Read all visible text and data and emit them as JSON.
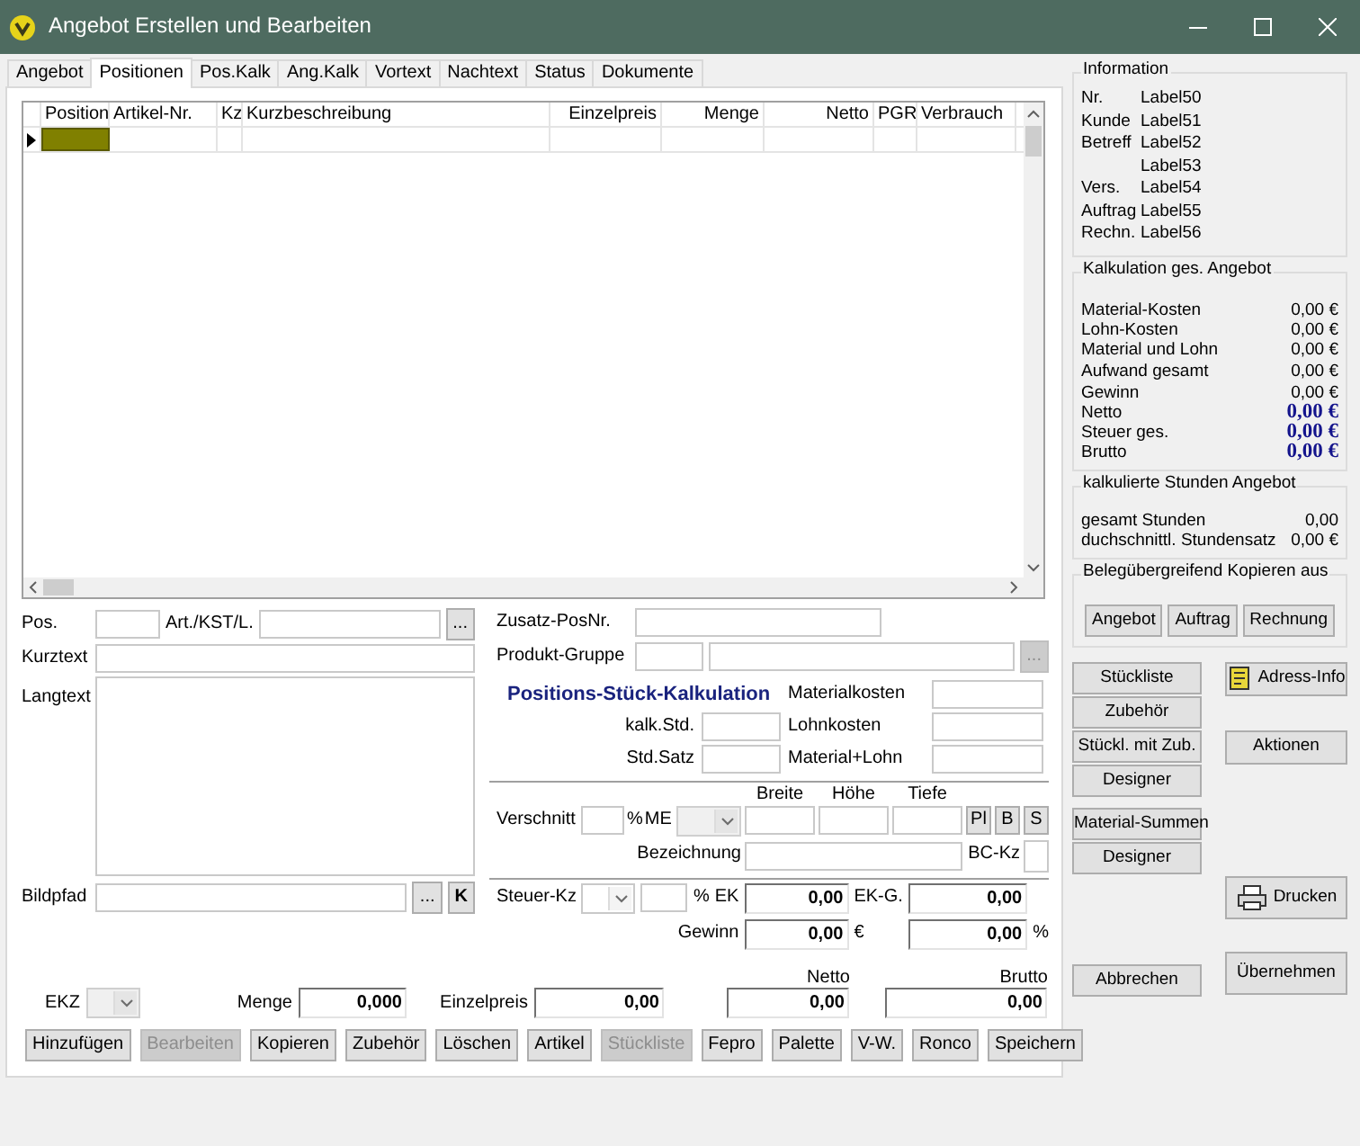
{
  "window": {
    "title": "Angebot Erstellen und Bearbeiten"
  },
  "tabs": [
    {
      "label": "Angebot",
      "selected": false
    },
    {
      "label": "Positionen",
      "selected": true
    },
    {
      "label": "Pos.Kalk",
      "selected": false
    },
    {
      "label": "Ang.Kalk",
      "selected": false
    },
    {
      "label": "Vortext",
      "selected": false
    },
    {
      "label": "Nachtext",
      "selected": false
    },
    {
      "label": "Status",
      "selected": false
    },
    {
      "label": "Dokumente",
      "selected": false
    }
  ],
  "grid": {
    "columns": [
      "Position",
      "Artikel-Nr.",
      "Kz",
      "Kurzbeschreibung",
      "Einzelpreis",
      "Menge",
      "Netto",
      "PGR",
      "Verbrauch"
    ],
    "rows": [
      {
        "current": true
      }
    ]
  },
  "position_form": {
    "pos": "Pos.",
    "art": "Art./KST/L.",
    "kurztext": "Kurztext",
    "langtext": "Langtext",
    "bildpfad": "Bildpfad",
    "browse": "...",
    "k_button": "K",
    "zusatz": "Zusatz-PosNr.",
    "produktgruppe": "Produkt-Gruppe",
    "produktgruppe_button_disabled": true,
    "kalk_title": "Positions-Stück-Kalkulation",
    "kalk_left": [
      "kalk.Std.",
      "Std.Satz"
    ],
    "kalk_right": [
      "Materialkosten",
      "Lohnkosten",
      "Material+Lohn"
    ],
    "verschnitt": "Verschnitt",
    "percent": "%",
    "me": "ME",
    "me_disabled": true,
    "dims": [
      "Breite",
      "Höhe",
      "Tiefe"
    ],
    "dim_buttons": [
      "Pl",
      "B",
      "S"
    ],
    "bezeichnung": "Bezeichnung",
    "bc_kz": "BC-Kz",
    "steuer": "Steuer-Kz",
    "ek": "EK",
    "ek_value": "0,00",
    "ekg": "EK-G.",
    "ekg_value": "0,00",
    "gewinn": "Gewinn",
    "gewinn_value": "0,00",
    "euro": "€",
    "gewinn_pct_value": "0,00"
  },
  "totals": {
    "ekz": "EKZ",
    "ekz_disabled": true,
    "menge": "Menge",
    "menge_value": "0,000",
    "einzelpreis": "Einzelpreis",
    "einzelpreis_value": "0,00",
    "netto": "Netto",
    "netto_value": "0,00",
    "brutto": "Brutto",
    "brutto_value": "0,00"
  },
  "action_buttons": [
    {
      "label": "Hinzufügen",
      "disabled": false
    },
    {
      "label": "Bearbeiten",
      "disabled": true
    },
    {
      "label": "Kopieren",
      "disabled": false
    },
    {
      "label": "Zubehör",
      "disabled": false
    },
    {
      "label": "Löschen",
      "disabled": false
    },
    {
      "label": "Artikel",
      "disabled": false
    },
    {
      "label": "Stückliste",
      "disabled": true
    },
    {
      "label": "Fepro",
      "disabled": false
    },
    {
      "label": "Palette",
      "disabled": false
    },
    {
      "label": "V-W.",
      "disabled": false
    },
    {
      "label": "Ronco",
      "disabled": false
    }
  ],
  "save_button": "Speichern",
  "info": {
    "title": "Information",
    "rows": [
      {
        "label": "Nr.",
        "value": "Label50"
      },
      {
        "label": "Kunde",
        "value": "Label51"
      },
      {
        "label": "Betreff",
        "value": "Label52"
      },
      {
        "value": "Label53"
      },
      {
        "label": "Vers.",
        "value": "Label54"
      },
      {
        "label": "Auftrag",
        "value": "Label55"
      },
      {
        "label": "Rechn.",
        "value": "Label56"
      }
    ]
  },
  "kalkulation": {
    "title": "Kalkulation ges. Angebot",
    "rows": [
      {
        "label": "Material-Kosten",
        "value": "0,00 €",
        "emphasis": false
      },
      {
        "label": "Lohn-Kosten",
        "value": "0,00 €",
        "emphasis": false
      },
      {
        "label": "Material und Lohn",
        "value": "0,00 €",
        "emphasis": false
      },
      {
        "label": "Aufwand gesamt",
        "value": "0,00 €",
        "emphasis": false
      },
      {
        "label": "Gewinn",
        "value": "0,00 €",
        "emphasis": false
      },
      {
        "label": "Netto",
        "value": "0,00 €",
        "emphasis": true
      },
      {
        "label": "Steuer ges.",
        "value": "0,00 €",
        "emphasis": true
      },
      {
        "label": "Brutto",
        "value": "0,00 €",
        "emphasis": true
      }
    ]
  },
  "stunden": {
    "title": "kalkulierte Stunden Angebot",
    "rows": [
      {
        "label": "gesamt Stunden",
        "value": "0,00"
      },
      {
        "label": "duchschnittl. Stundensatz",
        "value": "0,00 €"
      }
    ]
  },
  "kopieren": {
    "title": "Belegübergreifend Kopieren aus",
    "buttons": [
      "Angebot",
      "Auftrag",
      "Rechnung"
    ]
  },
  "side_buttons": {
    "left": [
      [
        "Stückliste",
        "Zubehör",
        "Stückl. mit Zub.",
        "Designer"
      ],
      [
        "Material-Summen",
        "Designer"
      ],
      [
        "Abbrechen"
      ]
    ],
    "right": [
      {
        "label": "Adress-Info"
      },
      {
        "label": "Aktionen"
      },
      {
        "label": "Drucken"
      },
      {
        "label": "Übernehmen"
      }
    ]
  }
}
